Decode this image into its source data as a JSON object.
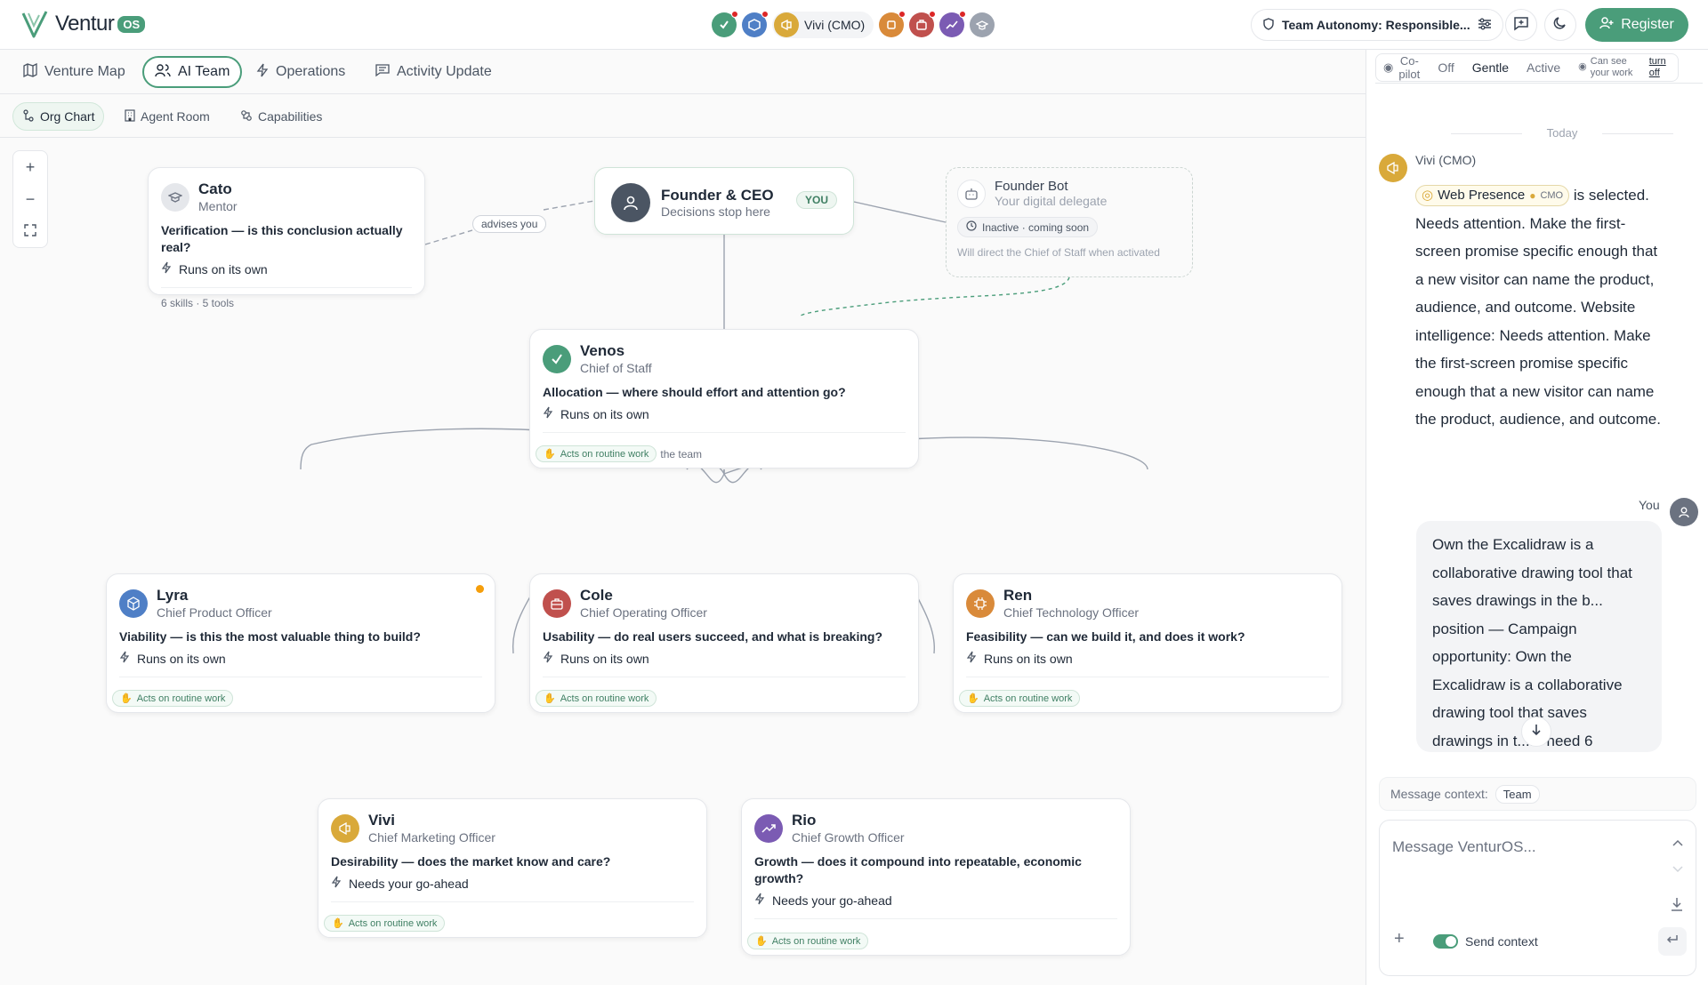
{
  "app": {
    "name": "Ventur",
    "badge": "OS"
  },
  "topbar": {
    "active_agent_label": "Vivi (CMO)",
    "autonomy_label": "Team Autonomy: Responsible...",
    "register_label": "Register"
  },
  "nav": {
    "tabs": [
      {
        "label": "Venture Map",
        "icon": "map-icon"
      },
      {
        "label": "AI Team",
        "icon": "users-icon"
      },
      {
        "label": "Operations",
        "icon": "bolt-icon"
      },
      {
        "label": "Activity Update",
        "icon": "message-icon"
      }
    ]
  },
  "subnav": {
    "tabs": [
      {
        "label": "Org Chart",
        "icon": "org-chart-icon"
      },
      {
        "label": "Agent Room",
        "icon": "building-icon"
      },
      {
        "label": "Capabilities",
        "icon": "capabilities-icon"
      }
    ]
  },
  "org": {
    "edge_label": "advises you",
    "ceo": {
      "name": "Founder & CEO",
      "role": "Decisions stop here",
      "badge": "YOU"
    },
    "bot": {
      "name": "Founder Bot",
      "role": "Your digital delegate",
      "status": "Inactive · coming soon",
      "note": "Will direct the Chief of Staff when activated"
    },
    "cato": {
      "name": "Cato",
      "role": "Mentor",
      "question": "Verification — is this conclusion actually real?",
      "mode": "Runs on its own",
      "footer": "6 skills · 5 tools"
    },
    "venos": {
      "name": "Venos",
      "role": "Chief of Staff",
      "question": "Allocation — where should effort and attention go?",
      "mode": "Runs on its own",
      "chip": "Acts on routine work",
      "chip_suffix": "the team"
    },
    "lyra": {
      "name": "Lyra",
      "role": "Chief Product Officer",
      "question": "Viability — is this the most valuable thing to build?",
      "mode": "Runs on its own",
      "chip": "Acts on routine work"
    },
    "cole": {
      "name": "Cole",
      "role": "Chief Operating Officer",
      "question": "Usability — do real users succeed, and what is breaking?",
      "mode": "Runs on its own",
      "chip": "Acts on routine work"
    },
    "ren": {
      "name": "Ren",
      "role": "Chief Technology Officer",
      "question": "Feasibility — can we build it, and does it work?",
      "mode": "Runs on its own",
      "chip": "Acts on routine work"
    },
    "vivi": {
      "name": "Vivi",
      "role": "Chief Marketing Officer",
      "question": "Desirability — does the market know and care?",
      "mode": "Needs your go-ahead",
      "chip": "Acts on routine work"
    },
    "rio": {
      "name": "Rio",
      "role": "Chief Growth Officer",
      "question": "Growth — does it compound into repeatable, economic growth?",
      "mode": "Needs your go-ahead",
      "chip": "Acts on routine work"
    }
  },
  "colors": {
    "accent": "#4a9d7a",
    "venos": "#4a9d7a",
    "lyra": "#4f7fc6",
    "cole": "#c0504d",
    "ren": "#d98a3a",
    "vivi": "#d9a93a",
    "rio": "#7b5bb3",
    "cato": "#9ca3af"
  },
  "panel": {
    "copilot": {
      "label": "Co-pilot",
      "options": [
        "Off",
        "Gentle",
        "Active"
      ],
      "selected": "Gentle",
      "privacy_note": "Can see your work",
      "turn_off": "turn off"
    },
    "day_divider": "Today",
    "agent_message": {
      "from": "Vivi (CMO)",
      "chip_label": "Web Presence",
      "chip_tag": "CMO",
      "text_suffix": "is selected. Needs attention. Make the first-screen promise specific enough that a new visitor can name the product, audience, and outcome. Website intelligence: Needs attention. Make the first-screen promise specific enough that a new visitor can name the product, audience, and outcome."
    },
    "user_message": {
      "from": "You",
      "text": "Own the Excalidraw is a collaborative drawing tool that saves drawings in the b... position — Campaign opportunity: Own the Excalidraw is a collaborative drawing tool that saves drawings in t.... I need 6"
    },
    "context": {
      "label": "Message context:",
      "value": "Team"
    },
    "composer": {
      "placeholder": "Message VenturOS...",
      "send_context_label": "Send context"
    }
  }
}
